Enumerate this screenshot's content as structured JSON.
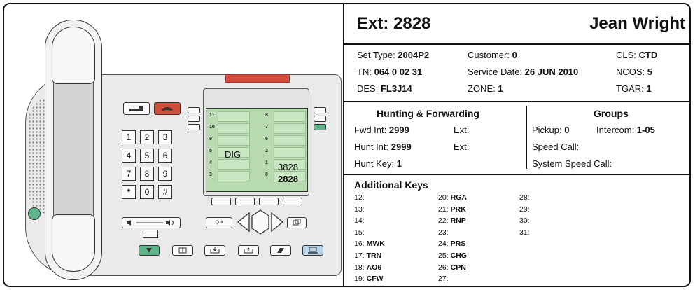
{
  "phone": {
    "keypad": [
      "1",
      "2",
      "3",
      "4",
      "5",
      "6",
      "7",
      "8",
      "9",
      "*",
      "0",
      "#"
    ],
    "lcd": {
      "left_numbers": [
        "11",
        "10",
        "9",
        "5",
        "4",
        "3"
      ],
      "right_numbers": [
        "8",
        "7",
        "6",
        "2",
        "1",
        "0"
      ],
      "dig_label": "DIG",
      "line1_value": "3828",
      "line0_value": "2828"
    },
    "quit_label": "Quit"
  },
  "header": {
    "ext": "Ext: 2828",
    "name": "Jean Wright"
  },
  "details": {
    "set_type_label": "Set Type: ",
    "set_type": "2004P2",
    "customer_label": "Customer: ",
    "customer": "0",
    "cls_label": "CLS: ",
    "cls": "CTD",
    "tn_label": "TN: ",
    "tn": "064 0 02 31",
    "service_date_label": "Service Date: ",
    "service_date": "26 JUN 2010",
    "ncos_label": "NCOS: ",
    "ncos": "5",
    "des_label": "DES: ",
    "des": "FL3J14",
    "zone_label": "ZONE: ",
    "zone": "1",
    "tgar_label": "TGAR: ",
    "tgar": "1"
  },
  "hunting": {
    "title": "Hunting & Forwarding",
    "fwd_int_label": "Fwd  Int: ",
    "fwd_int": "2999",
    "fwd_ext_label": "Ext:",
    "hunt_int_label": "Hunt Int: ",
    "hunt_int": "2999",
    "hunt_ext_label": "Ext:",
    "hunt_key_label": "Hunt Key: ",
    "hunt_key": "1"
  },
  "groups": {
    "title": "Groups",
    "pickup_label": "Pickup: ",
    "pickup": "0",
    "intercom_label": "Intercom: ",
    "intercom": "1-05",
    "speed_call_label": "Speed Call:",
    "system_speed_call_label": "System Speed Call:"
  },
  "additional_keys": {
    "title": "Additional Keys",
    "col1": [
      {
        "num": "12:",
        "val": ""
      },
      {
        "num": "13:",
        "val": ""
      },
      {
        "num": "14:",
        "val": ""
      },
      {
        "num": "15:",
        "val": ""
      },
      {
        "num": "16:",
        "val": "MWK"
      },
      {
        "num": "17:",
        "val": "TRN"
      },
      {
        "num": "18:",
        "val": "AO6"
      },
      {
        "num": "19:",
        "val": "CFW"
      }
    ],
    "col2": [
      {
        "num": "20:",
        "val": "RGA"
      },
      {
        "num": "21:",
        "val": "PRK"
      },
      {
        "num": "22:",
        "val": "RNP"
      },
      {
        "num": "23:",
        "val": ""
      },
      {
        "num": "24:",
        "val": "PRS"
      },
      {
        "num": "25:",
        "val": "CHG"
      },
      {
        "num": "26:",
        "val": "CPN"
      },
      {
        "num": "27:",
        "val": ""
      }
    ],
    "col3": [
      {
        "num": "28:",
        "val": ""
      },
      {
        "num": "29:",
        "val": ""
      },
      {
        "num": "30:",
        "val": ""
      },
      {
        "num": "31:",
        "val": ""
      }
    ]
  }
}
